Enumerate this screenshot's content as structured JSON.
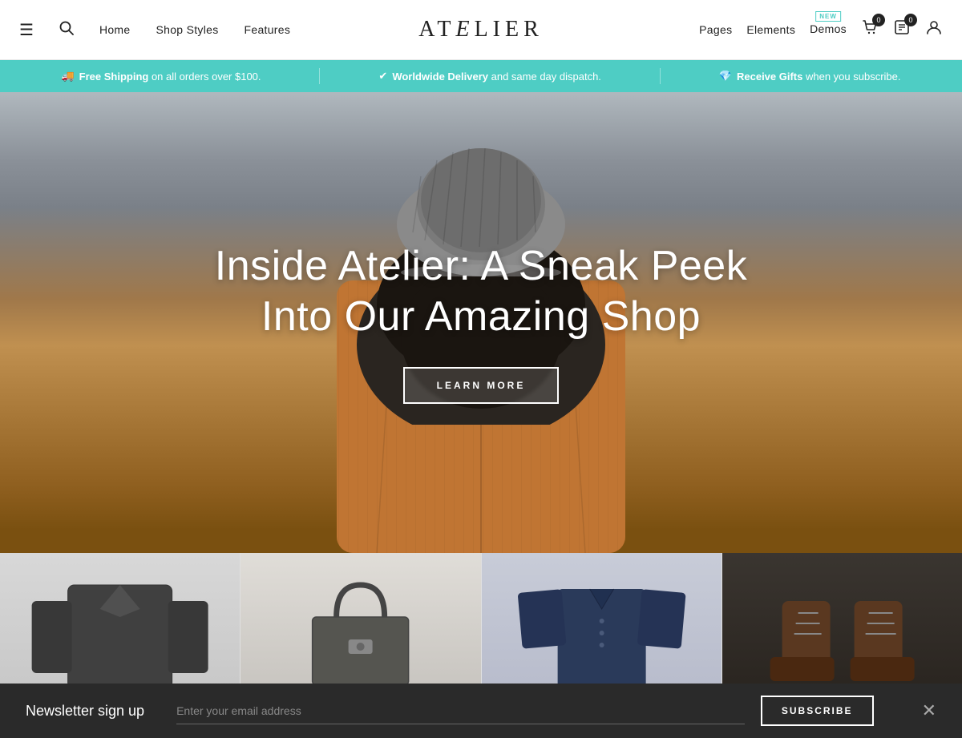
{
  "navbar": {
    "hamburger_icon": "☰",
    "search_icon": "🔍",
    "links": [
      {
        "label": "Home",
        "id": "home"
      },
      {
        "label": "Shop Styles",
        "id": "shop-styles"
      },
      {
        "label": "Features",
        "id": "features"
      }
    ],
    "logo_text": "ATELIER",
    "right_links": [
      {
        "label": "Pages",
        "id": "pages"
      },
      {
        "label": "Elements",
        "id": "elements"
      },
      {
        "label": "Demos",
        "id": "demos",
        "badge": "NEW"
      }
    ],
    "cart_count": "0",
    "wishlist_count": "0"
  },
  "announcement": {
    "items": [
      {
        "bold": "Free Shipping",
        "text": " on all orders over $100.",
        "icon": "🚚"
      },
      {
        "bold": "Worldwide Delivery",
        "text": " and same day dispatch.",
        "icon": "✔"
      },
      {
        "bold": "Receive Gifts",
        "text": " when you subscribe.",
        "icon": "💎"
      }
    ]
  },
  "hero": {
    "title_line1": "Inside Atelier: A Sneak Peek",
    "title_line2": "Into Our Amazing Shop",
    "cta_label": "LEARN MORE"
  },
  "products": [
    {
      "id": "product-1",
      "type": "jacket"
    },
    {
      "id": "product-2",
      "type": "bag"
    },
    {
      "id": "product-3",
      "type": "shirt"
    },
    {
      "id": "product-4",
      "type": "boots"
    }
  ],
  "newsletter": {
    "title": "Newsletter sign up",
    "input_placeholder": "Enter your email address",
    "subscribe_label": "SUBSCRIBE",
    "close_icon": "✕"
  }
}
